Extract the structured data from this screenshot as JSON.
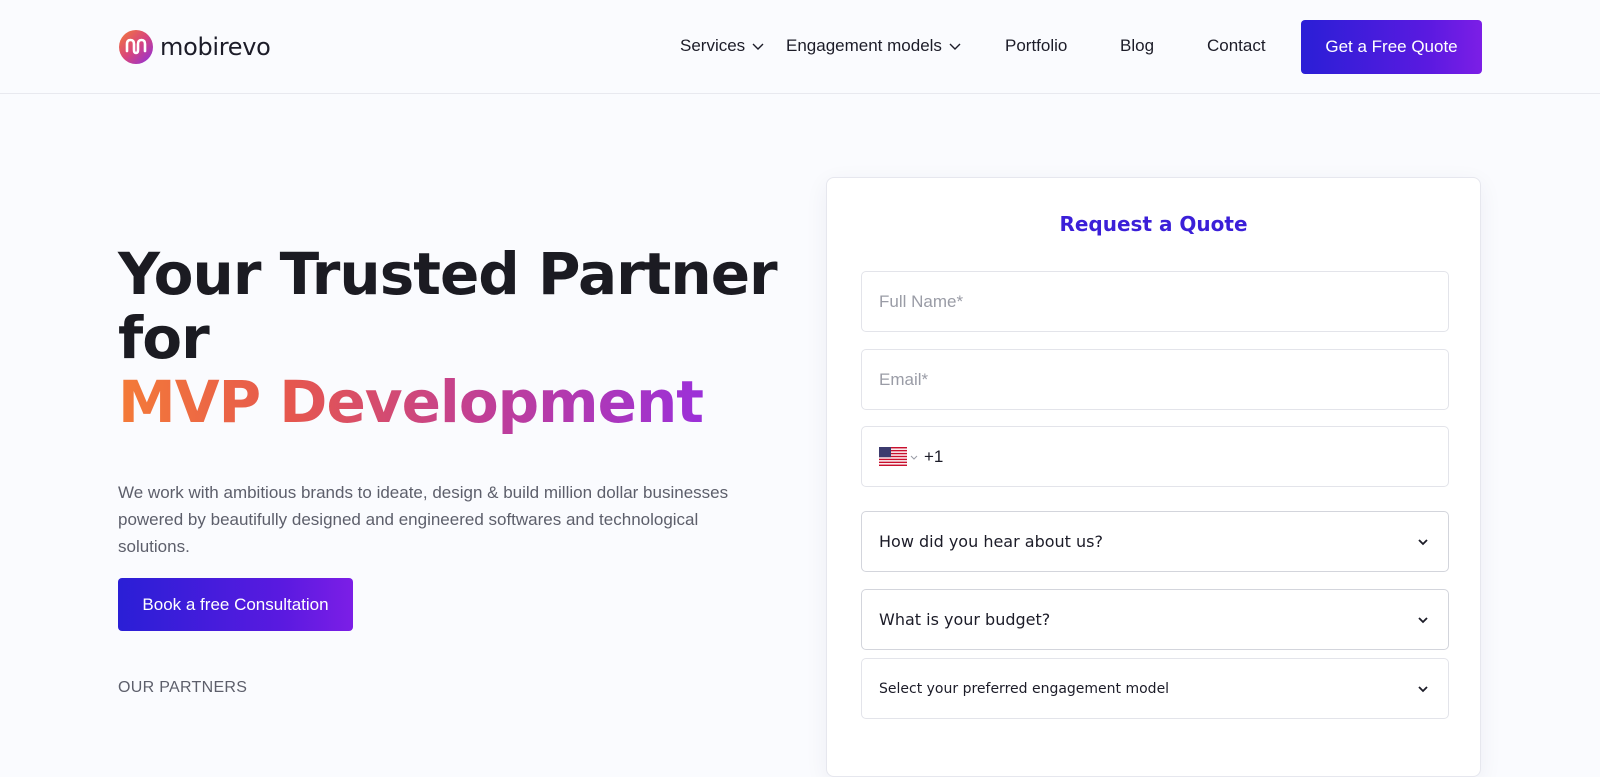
{
  "brand": {
    "name": "mobirevo",
    "gradient_start": "#f47b38",
    "gradient_end": "#9b30d9"
  },
  "nav": {
    "items": [
      {
        "label": "Services",
        "dropdown": true
      },
      {
        "label": "Engagement models",
        "dropdown": true
      },
      {
        "label": "Portfolio",
        "dropdown": false
      },
      {
        "label": "Blog",
        "dropdown": false
      },
      {
        "label": "Contact",
        "dropdown": false
      }
    ],
    "cta_label": "Get a Free Quote"
  },
  "hero": {
    "title_line1": "Your Trusted Partner",
    "title_line2": "for",
    "title_highlight": "MVP Development",
    "description": "We work with ambitious brands to ideate, design & build million dollar businesses powered by beautifully designed and engineered softwares and technological solutions.",
    "cta_label": "Book a free Consultation",
    "partners_label": "OUR PARTNERS"
  },
  "form": {
    "title": "Request a Quote",
    "full_name_placeholder": "Full Name*",
    "email_placeholder": "Email*",
    "phone_country_flag": "us-flag-icon",
    "phone_value": "+1",
    "hear_about_label": "How did you hear about us?",
    "budget_label": "What is your budget?",
    "engagement_label": "Select your preferred engagement model"
  },
  "colors": {
    "accent": "#3b1fd8",
    "button_gradient_start": "#2a1fd6",
    "button_gradient_end": "#7c1ee6",
    "background": "#fafbfe"
  }
}
